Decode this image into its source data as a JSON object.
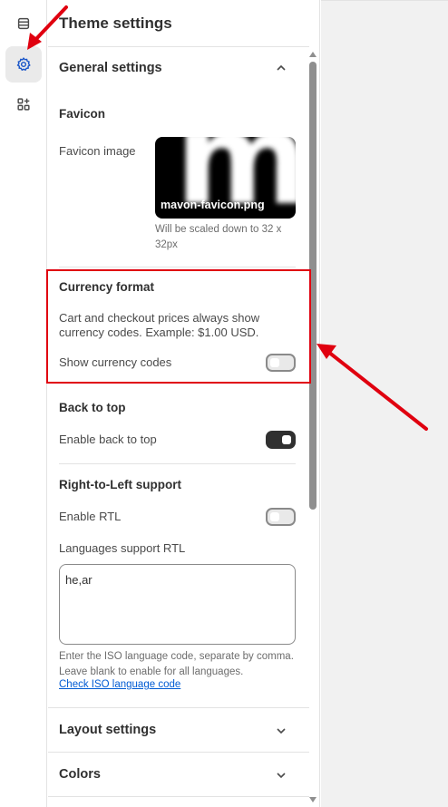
{
  "sidebar": {
    "items": [
      {
        "icon": "sections-icon"
      },
      {
        "icon": "gear-icon",
        "active": true
      },
      {
        "icon": "apps-icon"
      }
    ]
  },
  "panel": {
    "title": "Theme settings",
    "general": {
      "heading": "General settings",
      "favicon": {
        "title": "Favicon",
        "image_label": "Favicon image",
        "filename": "mavon-favicon.png",
        "help": "Will be scaled down to 32 x 32px"
      },
      "currency": {
        "title": "Currency format",
        "description": "Cart and checkout prices always show currency codes. Example: $1.00 USD.",
        "toggle_label": "Show currency codes",
        "toggle_on": false
      },
      "back_to_top": {
        "title": "Back to top",
        "toggle_label": "Enable back to top",
        "toggle_on": true
      },
      "rtl": {
        "title": "Right-to-Left support",
        "toggle_label": "Enable RTL",
        "toggle_on": false,
        "languages_label": "Languages support RTL",
        "languages_value": "he,ar",
        "help": "Enter the ISO language code, separate by comma. Leave blank to enable for all languages.",
        "link": "Check ISO language code"
      }
    },
    "layout_heading": "Layout settings",
    "colors_heading": "Colors"
  },
  "annotation": {
    "color": "#e0000f"
  }
}
